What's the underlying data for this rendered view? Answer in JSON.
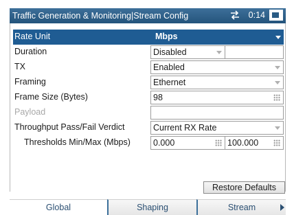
{
  "titlebar": {
    "title": "Traffic Generation & Monitoring|Stream Config",
    "time": "0:14",
    "network_icon": "network-arrows-icon",
    "battery_icon": "battery-icon"
  },
  "rows": {
    "rate_unit": {
      "label": "Rate Unit",
      "value": "Mbps"
    },
    "duration": {
      "label": "Duration",
      "value": "Disabled"
    },
    "tx": {
      "label": "TX",
      "value": "Enabled"
    },
    "framing": {
      "label": "Framing",
      "value": "Ethernet"
    },
    "frame_size": {
      "label": "Frame Size (Bytes)",
      "value": "98"
    },
    "payload": {
      "label": "Payload"
    },
    "verdict": {
      "label": "Throughput Pass/Fail Verdict",
      "value": "Current RX Rate"
    },
    "thresholds": {
      "label": "Thresholds Min/Max (Mbps)",
      "min": "0.000",
      "max": "100.000"
    }
  },
  "restore_defaults_label": "Restore Defaults",
  "tabs": [
    {
      "label": "Global",
      "active": true
    },
    {
      "label": "Shaping",
      "active": false
    },
    {
      "label": "Stream",
      "active": false
    }
  ],
  "colors": {
    "titlebar": "#2a5b84",
    "selected_row": "#1f5c93",
    "tab_text": "#2b4f72"
  }
}
